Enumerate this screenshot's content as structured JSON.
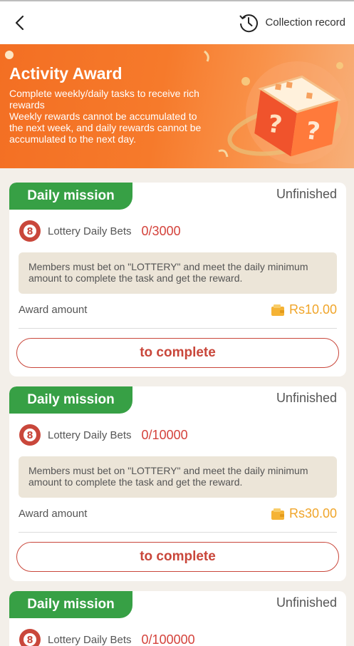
{
  "header": {
    "back_icon": "chevron-left-icon",
    "record_icon": "history-clock-icon",
    "record_label": "Collection record"
  },
  "banner": {
    "title": "Activity Award",
    "lines": [
      "Complete weekly/daily tasks to receive rich rewards",
      "Weekly rewards cannot be accumulated to the next week, and daily rewards cannot be accumulated to the next day."
    ]
  },
  "missions": [
    {
      "tag": "Daily mission",
      "status": "Unfinished",
      "task_label": "Lottery Daily Bets",
      "progress": "0/3000",
      "description": "Members must bet on \"LOTTERY\" and meet the daily minimum amount to complete the task and get the reward.",
      "award_label": "Award amount",
      "award_amount": "Rs10.00",
      "button_label": "to complete"
    },
    {
      "tag": "Daily mission",
      "status": "Unfinished",
      "task_label": "Lottery Daily Bets",
      "progress": "0/10000",
      "description": "Members must bet on \"LOTTERY\" and meet the daily minimum amount to complete the task and get the reward.",
      "award_label": "Award amount",
      "award_amount": "Rs30.00",
      "button_label": "to complete"
    },
    {
      "tag": "Daily mission",
      "status": "Unfinished",
      "task_label": "Lottery Daily Bets",
      "progress": "0/100000"
    }
  ],
  "colors": {
    "tag_green": "#37a045",
    "progress_red": "#d4423b",
    "award_gold": "#f0a52a",
    "button_red": "#c9473b",
    "banner_orange": "#f36f23"
  }
}
